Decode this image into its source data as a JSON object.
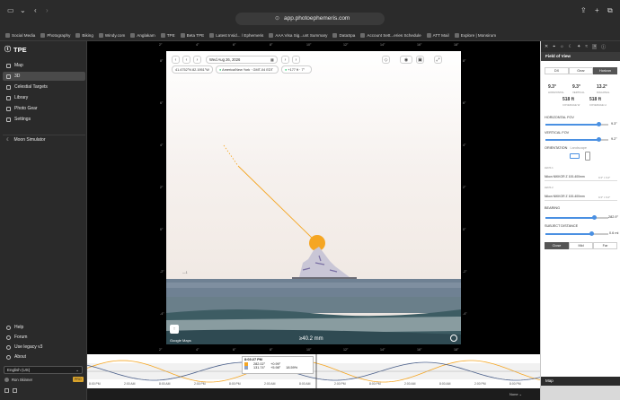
{
  "browser": {
    "url": "app.photoephemeris.com",
    "bookmarks": [
      {
        "label": "Social Media"
      },
      {
        "label": "Photography"
      },
      {
        "label": "Biking"
      },
      {
        "label": "Windy.com"
      },
      {
        "label": "Anglakam"
      },
      {
        "label": "TPE"
      },
      {
        "label": "Beta TPE"
      },
      {
        "label": "Latest Insid... / Ephemeris"
      },
      {
        "label": "AAA Visa Sig...unt Summary"
      },
      {
        "label": "DataSpa"
      },
      {
        "label": "Account Sett...eries Schedule"
      },
      {
        "label": "ATT Mail"
      },
      {
        "label": "Explore | Monsirum"
      }
    ]
  },
  "sidebar": {
    "brand": "TPE",
    "items": [
      {
        "label": "Map",
        "icon": "map-icon"
      },
      {
        "label": "3D",
        "icon": "cube-icon"
      },
      {
        "label": "Celestial Targets",
        "icon": "target-icon"
      },
      {
        "label": "Library",
        "icon": "library-icon"
      },
      {
        "label": "Photo Gear",
        "icon": "camera-icon"
      },
      {
        "label": "Settings",
        "icon": "gear-icon"
      }
    ],
    "moon_simulator": "Moon Simulator",
    "footer": [
      {
        "label": "Help",
        "icon": "help-icon"
      },
      {
        "label": "Forum",
        "icon": "forum-icon"
      },
      {
        "label": "Use legacy v3",
        "icon": "legacy-icon"
      },
      {
        "label": "About",
        "icon": "info-icon"
      }
    ],
    "language": "English (US)",
    "user": "Ron Skinner",
    "user_badge": "PRO"
  },
  "viewer": {
    "date": "Wed Aug 26, 2026",
    "coords": "41.4752°N 82.1951°W",
    "timezone": "America/New York · GMT-04 EDT",
    "elevation": "+177 ft · 7°",
    "attribution": "Google Maps",
    "scale": "≥40.2 mm"
  },
  "timeline": {
    "time": "8:03:27 PM",
    "sun_az": "282.02°",
    "sun_alt": "+0.99°",
    "moon_az": "131.74°",
    "moon_alt": "+5.98°",
    "moon_phase": "18.59%",
    "ticks": [
      "8:00 PM",
      "2:00 AM",
      "8:00 AM",
      "2:00 PM",
      "8:00 PM",
      "2:00 AM",
      "8:00 AM",
      "2:00 PM",
      "8:00 PM",
      "2:00 AM",
      "8:00 AM",
      "2:00 PM",
      "8:00 PM"
    ]
  },
  "panel": {
    "title": "Field of View",
    "tabs": [
      "DX",
      "Gear",
      "Horizon"
    ],
    "selected_tab": "Horizon",
    "stats": [
      {
        "value": "9.3°",
        "label": "HORIZONTAL"
      },
      {
        "value": "9.3°",
        "label": "VERTICAL"
      },
      {
        "value": "13.2°",
        "label": "DIAGONAL"
      }
    ],
    "distances": [
      {
        "value": "518 ft",
        "label": "COVERAGE W"
      },
      {
        "value": "518 ft",
        "label": "COVERAGE H"
      }
    ],
    "horizontal_fov_label": "HORIZONTAL FOV",
    "horizontal_fov_value": "9.3°",
    "horizontal_fov_level": 0.85,
    "vertical_fov_label": "VERTICAL FOV",
    "vertical_fov_value": "9.2°",
    "vertical_fov_level": 0.85,
    "orientation_label": "ORIENTATION",
    "orientation_sub": "Landscape",
    "lens_label_1": "LENS 1",
    "lens_1": "Nikon NIKKOR Z 100-400mm",
    "lens_1_fov": "9.3° × 6.2°",
    "lens_label_2": "LENS 2",
    "lens_2": "Nikon NIKKOR Z 100-400mm",
    "lens_2_fov": "9.3° × 6.2°",
    "bearing_label": "BEARING",
    "bearing_value": "282.9°",
    "bearing_level": 0.78,
    "subject_label": "SUBJECT DISTANCE",
    "subject_value": "0.6 mi",
    "subject_level": 0.74,
    "distance_buttons": [
      "Close",
      "Mid",
      "Far"
    ],
    "selected_distance": "Close",
    "map_label": "Map"
  },
  "colors": {
    "sun_line": "#f5a623",
    "sun": "#f5a623",
    "accent": "#4a90e2"
  }
}
